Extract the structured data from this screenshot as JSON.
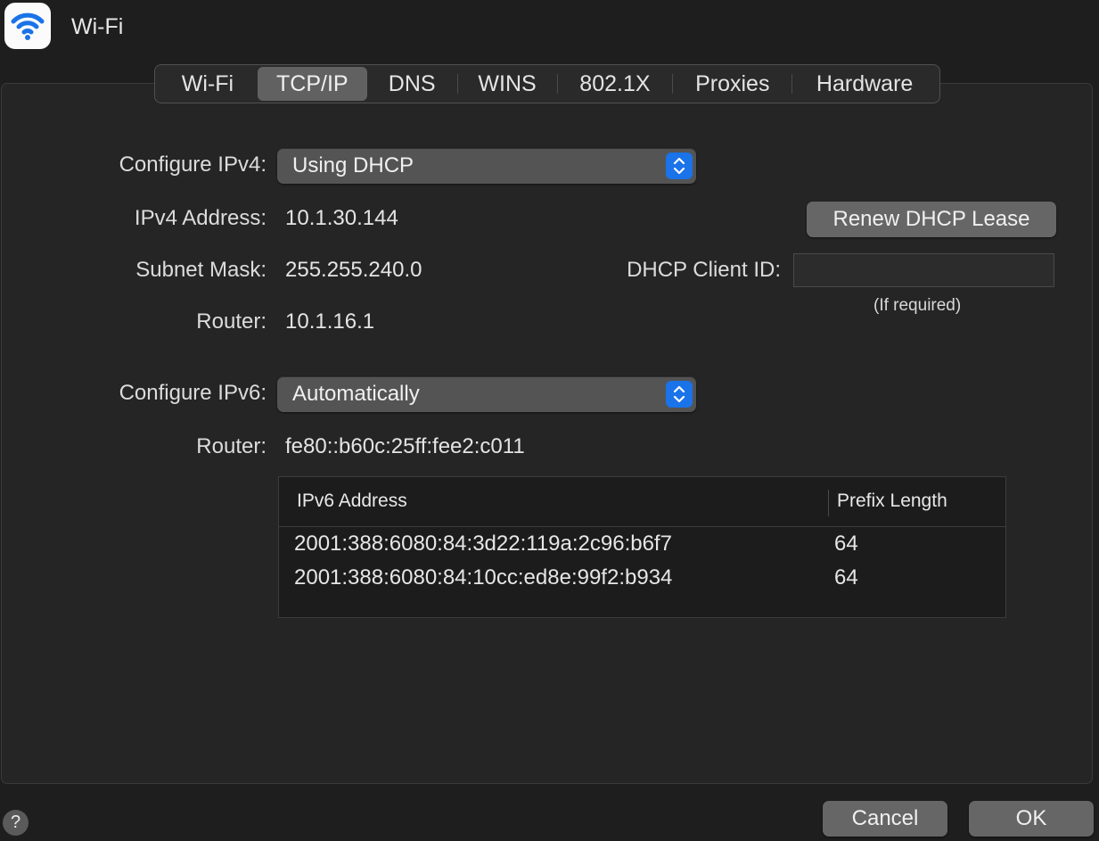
{
  "header": {
    "title": "Wi-Fi",
    "icon": "wifi-icon"
  },
  "tabs": [
    {
      "label": "Wi-Fi",
      "active": false
    },
    {
      "label": "TCP/IP",
      "active": true
    },
    {
      "label": "DNS",
      "active": false
    },
    {
      "label": "WINS",
      "active": false
    },
    {
      "label": "802.1X",
      "active": false
    },
    {
      "label": "Proxies",
      "active": false
    },
    {
      "label": "Hardware",
      "active": false
    }
  ],
  "ipv4": {
    "configure_label": "Configure IPv4:",
    "configure_value": "Using DHCP",
    "address_label": "IPv4 Address:",
    "address_value": "10.1.30.144",
    "subnet_label": "Subnet Mask:",
    "subnet_value": "255.255.240.0",
    "router_label": "Router:",
    "router_value": "10.1.16.1"
  },
  "dhcp": {
    "renew_label": "Renew DHCP Lease",
    "client_id_label": "DHCP Client ID:",
    "client_id_value": "",
    "client_id_hint": "(If required)"
  },
  "ipv6": {
    "configure_label": "Configure IPv6:",
    "configure_value": "Automatically",
    "router_label": "Router:",
    "router_value": "fe80::b60c:25ff:fee2:c011",
    "table": {
      "columns": [
        "IPv6 Address",
        "Prefix Length"
      ],
      "rows": [
        {
          "address": "2001:388:6080:84:3d22:119a:2c96:b6f7",
          "prefix": "64"
        },
        {
          "address": "2001:388:6080:84:10cc:ed8e:99f2:b934",
          "prefix": "64"
        }
      ]
    }
  },
  "footer": {
    "help_label": "?",
    "cancel_label": "Cancel",
    "ok_label": "OK"
  },
  "colors": {
    "accent": "#1a73e8",
    "wifi_icon": "#1a73e8",
    "background": "#1e1e1e"
  }
}
